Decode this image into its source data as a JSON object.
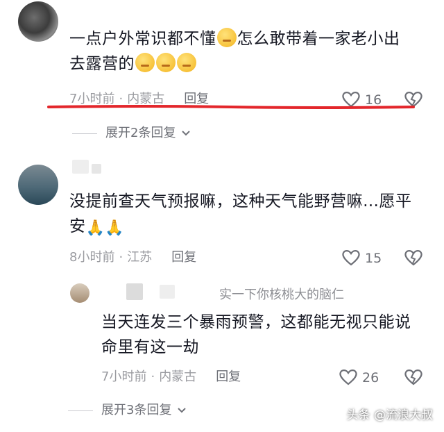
{
  "comments": [
    {
      "text_line1_a": "一点户外常识都不懂",
      "text_line1_b": "怎么敢带着一家老小出",
      "text_line2": "去露营的",
      "time": "7小时前",
      "location": "内蒙古",
      "reply_label": "回复",
      "likes": "16",
      "expand": "展开2条回复"
    },
    {
      "text_line1": "没提前查天气预报嘛，这种天气能野营嘛…愿平",
      "text_line2": "安",
      "time": "8小时前",
      "location": "江苏",
      "reply_label": "回复",
      "likes": "15"
    },
    {
      "reply_target_partial": "实一下你核桃大的脑仁",
      "text_line1": "当天连发三个暴雨预警，这都能无视只能说",
      "text_line2": "命里有这一劫",
      "time": "7小时前",
      "location": "内蒙古",
      "reply_label": "回复",
      "likes": "26",
      "expand": "展开3条回复"
    }
  ],
  "watermark": "头条 @流浪大叔",
  "colors": {
    "annotation_red": "#e3262b",
    "meta_gray": "#9a9ba0"
  }
}
